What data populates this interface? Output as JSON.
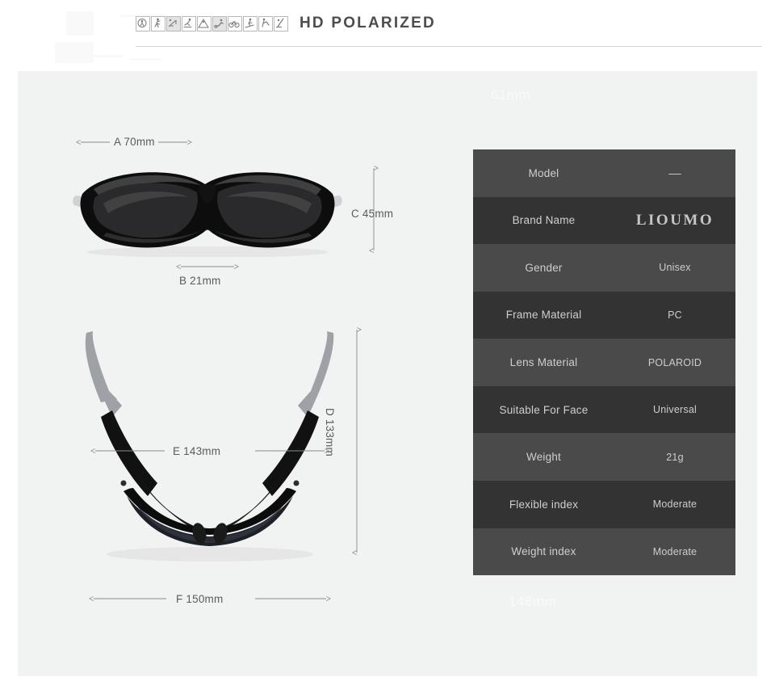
{
  "header": {
    "title": "HD POLARIZED",
    "icons": [
      {
        "name": "hiking-icon",
        "shaded": false
      },
      {
        "name": "running-icon",
        "shaded": false
      },
      {
        "name": "fishing-icon",
        "shaded": true
      },
      {
        "name": "skating-icon",
        "shaded": false
      },
      {
        "name": "climbing-icon",
        "shaded": false
      },
      {
        "name": "driving-icon",
        "shaded": true
      },
      {
        "name": "cycling-icon",
        "shaded": false
      },
      {
        "name": "skiing-icon",
        "shaded": false
      },
      {
        "name": "golf-icon",
        "shaded": false
      },
      {
        "name": "surfing-icon",
        "shaded": false
      }
    ]
  },
  "watermarks": {
    "top": "61mm",
    "bottom": "148mm"
  },
  "diagram_front": {
    "label_a": "A 70mm",
    "label_b": "B 21mm",
    "label_c": "C 45mm"
  },
  "diagram_top": {
    "label_d": "D 133mm",
    "label_e": "E 143mm",
    "label_f": "F 150mm"
  },
  "spec_table": {
    "rows": [
      {
        "key": "Model",
        "value": "––",
        "style": "dash"
      },
      {
        "key": "Brand Name",
        "value": "LIOUMO",
        "style": "brand"
      },
      {
        "key": "Gender",
        "value": "Unisex",
        "style": "plain"
      },
      {
        "key": "Frame Material",
        "value": "PC",
        "style": "plain"
      },
      {
        "key": "Lens Material",
        "value": "POLAROID",
        "style": "plain"
      },
      {
        "key": "Suitable For Face",
        "value": "Universal",
        "style": "plain"
      },
      {
        "key": "Weight",
        "value": "21g",
        "style": "plain"
      },
      {
        "key": "Flexible index",
        "value": "Moderate",
        "style": "plain"
      },
      {
        "key": "Weight index",
        "value": "Moderate",
        "style": "plain"
      }
    ]
  },
  "colors": {
    "panel_bg": "#f1f2f2",
    "row_light": "#4a4a4a",
    "row_dark": "#333333",
    "title": "#4d4d4d",
    "dimension_text": "#5b5b5b"
  }
}
